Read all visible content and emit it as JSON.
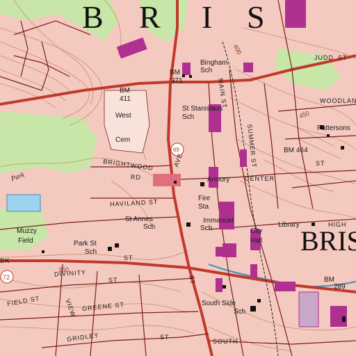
{
  "map": {
    "region_letters": [
      "B",
      "R",
      "I",
      "S"
    ],
    "town_label": "BRIST",
    "colors": {
      "background": "#fbeee6",
      "urban_tint": "#f4c9bf",
      "woodland": "#c8e6a8",
      "water": "#9ed3ee",
      "contour": "#c98e6b",
      "road_primary": "#c0392b",
      "road_minor": "#7a1d1d",
      "building": "#b03090",
      "route_shield": "#e07080"
    },
    "labels": {
      "bingham": "Bingham",
      "sch1": "Sch",
      "bm_371": "BM",
      "elev_371": "371",
      "bm_411": "BM",
      "elev_411": "411",
      "west": "West",
      "cem": "Cem",
      "st_stanislaus": "St Stanislaus",
      "sch2": "Sch",
      "brightwood": "BRIGHTWOOD",
      "rd": "RD",
      "armory": "Armory",
      "center": "CENTER",
      "fire": "Fire",
      "sta": "Sta",
      "haviland": "HAVILAND ST",
      "st_annes": "St Annes",
      "sch3": "Sch",
      "immanuel": "Immanuel",
      "sch4": "Sch",
      "library": "Library",
      "high": "HIGH",
      "city": "City",
      "hall": "Hall",
      "muzzy": "Muzzy",
      "field": "Field",
      "park_st": "Park St",
      "sch5": "Sch",
      "st_near_park": "ST",
      "divinity": "DIVINITY",
      "st_div": "ST",
      "field_st": "FIELD ST",
      "greene_st": "GREENE ST",
      "view": "VIEW",
      "gridley": "GRIDLEY",
      "st_grid": "ST",
      "south_side": "South Side",
      "sch6": "Sch",
      "south": "SOUTH",
      "bm_289": "BM",
      "elev_289": "289",
      "pattersons": "Pattersons",
      "bm_464": "BM",
      "elev_464": "464",
      "st_right": "ST",
      "woodland": "WOODLAND",
      "judd": "JUDD",
      "st_judd": "ST",
      "summer_st": "SUMMER ST",
      "main_st": "MAIN ST",
      "park_lbl": "Park",
      "ave": "AVE",
      "st_main_s": "ST",
      "dk": "DK",
      "route_72": "72",
      "contour_350": "350",
      "contour_400": "400",
      "contour_450": "450",
      "route_shield_69": "69"
    }
  }
}
